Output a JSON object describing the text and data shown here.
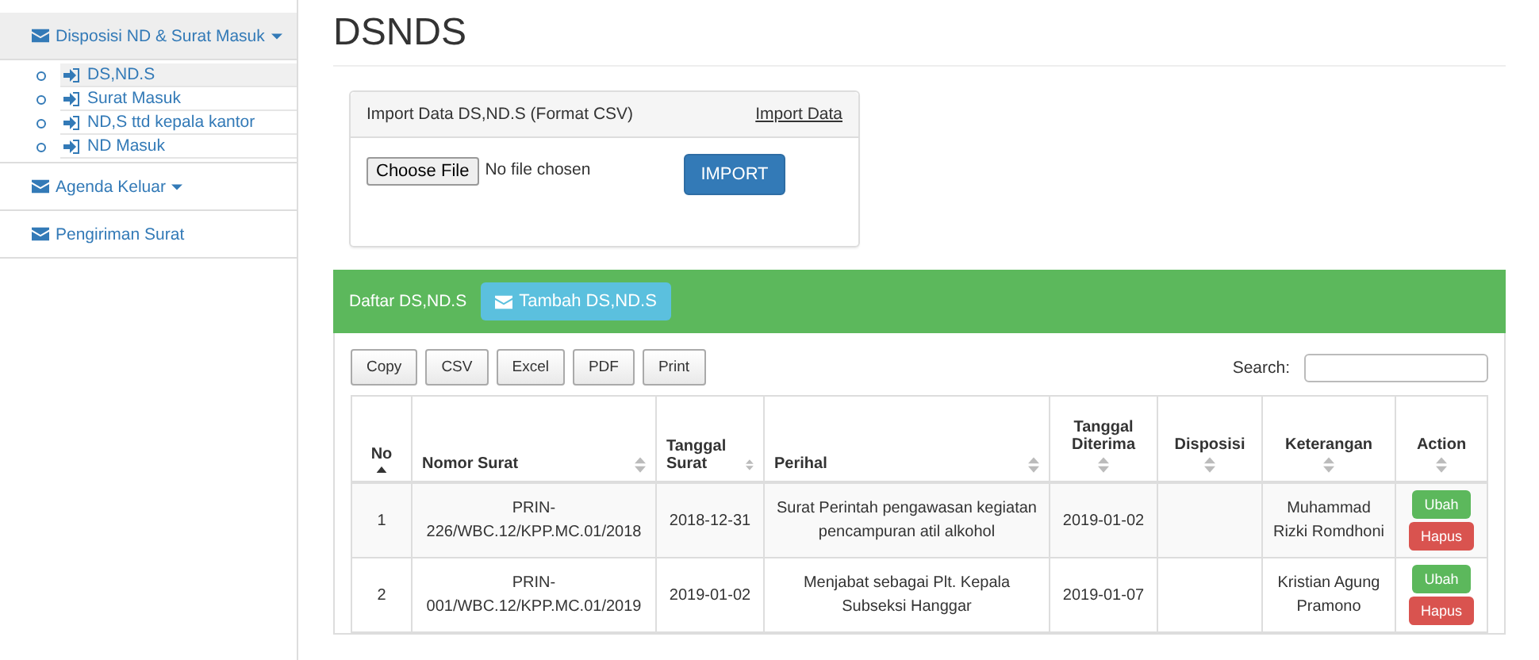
{
  "sidebar": {
    "menus": [
      {
        "label": "Disposisi ND & Surat Masuk",
        "expanded": true,
        "has_caret": true,
        "children": [
          {
            "label": "DS,ND.S",
            "selected": true
          },
          {
            "label": "Surat Masuk",
            "selected": false
          },
          {
            "label": "ND,S ttd kepala kantor",
            "selected": false
          },
          {
            "label": "ND Masuk",
            "selected": false
          }
        ]
      },
      {
        "label": "Agenda Keluar",
        "expanded": false,
        "has_caret": true
      },
      {
        "label": "Pengiriman Surat",
        "expanded": false,
        "has_caret": false
      }
    ]
  },
  "page_title": "DSNDS",
  "import_panel": {
    "title": "Import Data DS,ND.S (Format CSV)",
    "link": "Import Data",
    "file_button": "Choose File",
    "file_status": "No file chosen",
    "submit": "IMPORT"
  },
  "list_panel": {
    "title": "Daftar DS,ND.S",
    "add_button": "Tambah DS,ND.S"
  },
  "export_buttons": [
    "Copy",
    "CSV",
    "Excel",
    "PDF",
    "Print"
  ],
  "search": {
    "label": "Search:"
  },
  "table": {
    "columns": [
      {
        "label": "No",
        "sorted": true
      },
      {
        "label": "Nomor Surat",
        "sorted": false
      },
      {
        "label": "Tanggal Surat",
        "sorted": false
      },
      {
        "label": "Perihal",
        "sorted": false
      },
      {
        "label": "Tanggal Diterima",
        "sorted": false
      },
      {
        "label": "Disposisi",
        "sorted": false
      },
      {
        "label": "Keterangan",
        "sorted": false
      },
      {
        "label": "Action",
        "sorted": false
      }
    ],
    "rows": [
      {
        "no": "1",
        "nomor": "PRIN-226/WBC.12/KPP.MC.01/2018",
        "tanggal": "2018-12-31",
        "perihal": "Surat Perintah pengawasan kegiatan pencampuran atil alkohol",
        "diterima": "2019-01-02",
        "keterangan": "Muhammad Rizki Romdhoni",
        "actions": [
          "Ubah",
          "Hapus"
        ]
      },
      {
        "no": "2",
        "nomor": "PRIN-001/WBC.12/KPP.MC.01/2019",
        "tanggal": "2019-01-02",
        "perihal": "Menjabat sebagai Plt. Kepala Subseksi Hanggar",
        "diterima": "2019-01-07",
        "keterangan": "Kristian Agung Pramono",
        "actions": [
          "Ubah",
          "Hapus"
        ]
      }
    ]
  }
}
